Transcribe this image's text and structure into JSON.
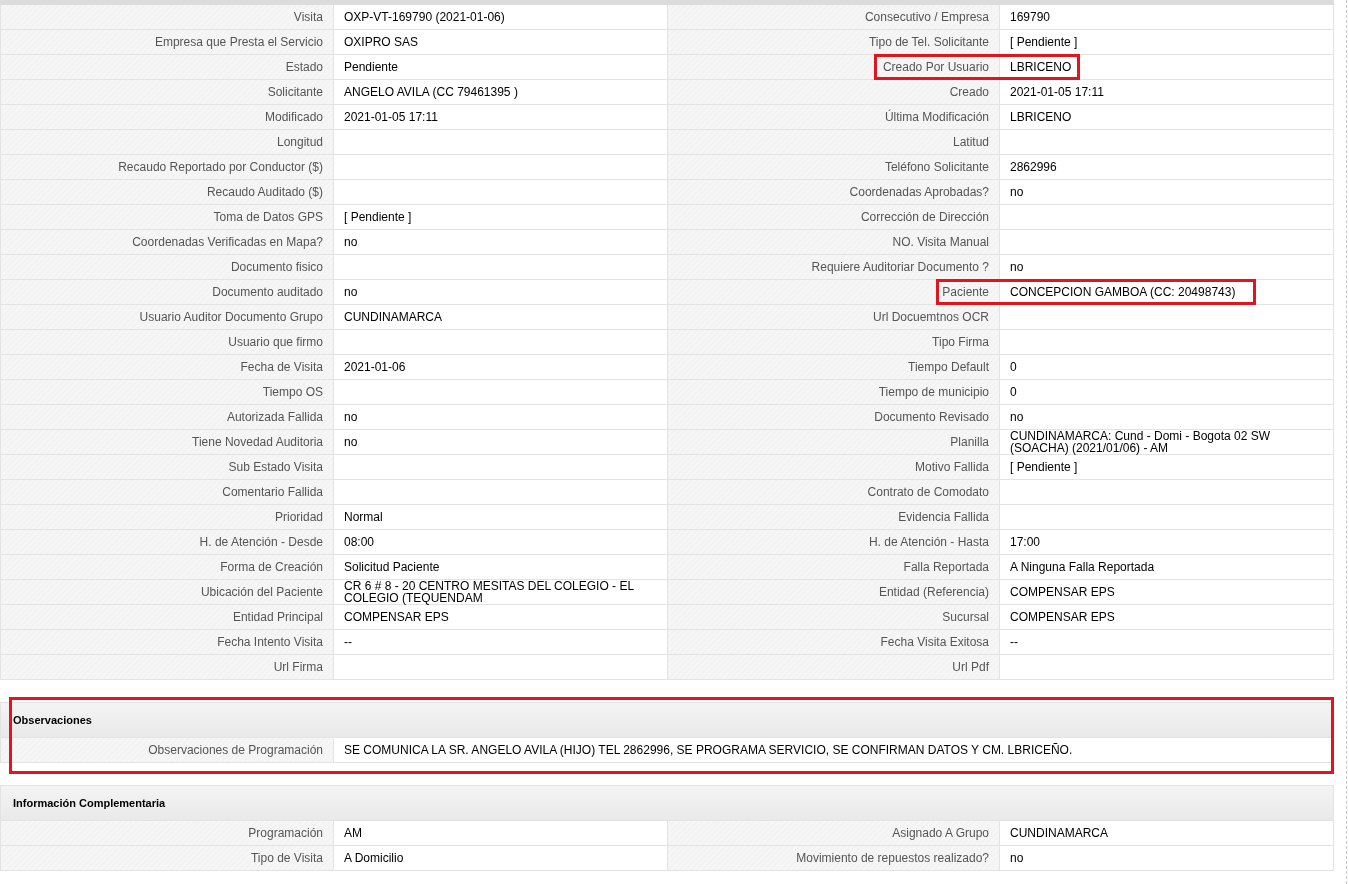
{
  "main_table": {
    "rows": [
      {
        "cells": [
          {
            "label": "Visita",
            "value": "OXP-VT-169790 (2021-01-06)",
            "highlighted": false
          },
          {
            "label": "Consecutivo / Empresa",
            "value": "169790",
            "highlighted": false
          }
        ]
      },
      {
        "cells": [
          {
            "label": "Empresa que Presta el Servicio",
            "value": "OXIPRO SAS",
            "highlighted": false
          },
          {
            "label": "Tipo de Tel. Solicitante",
            "value": "[ Pendiente ]",
            "highlighted": false
          }
        ]
      },
      {
        "cells": [
          {
            "label": "Estado",
            "value": "Pendiente",
            "highlighted": false
          },
          {
            "label": "Creado Por Usuario",
            "value": "LBRICENO",
            "highlighted": true
          }
        ]
      },
      {
        "cells": [
          {
            "label": "Solicitante",
            "value": "ANGELO AVILA (CC 79461395 )",
            "highlighted": false
          },
          {
            "label": "Creado",
            "value": "2021-01-05 17:11",
            "highlighted": false
          }
        ]
      },
      {
        "cells": [
          {
            "label": "Modificado",
            "value": "2021-01-05 17:11",
            "highlighted": false
          },
          {
            "label": "Última Modificación",
            "value": "LBRICENO",
            "highlighted": false
          }
        ]
      },
      {
        "cells": [
          {
            "label": "Longitud",
            "highlighted": false
          },
          {
            "label": "Latitud",
            "highlighted": false
          }
        ]
      },
      {
        "cells": [
          {
            "label": "Recaudo Reportado por Conductor ($)",
            "highlighted": false
          },
          {
            "label": "Teléfono Solicitante",
            "value": "2862996",
            "highlighted": false
          }
        ]
      },
      {
        "cells": [
          {
            "label": "Recaudo Auditado ($)",
            "highlighted": false
          },
          {
            "label": "Coordenadas Aprobadas?",
            "value": "no",
            "highlighted": false
          }
        ]
      },
      {
        "cells": [
          {
            "label": "Toma de Datos GPS",
            "value": "[ Pendiente ]",
            "highlighted": false
          },
          {
            "label": "Corrección de Dirección",
            "highlighted": false
          }
        ]
      },
      {
        "cells": [
          {
            "label": "Coordenadas Verificadas en Mapa?",
            "value": "no",
            "highlighted": false
          },
          {
            "label": "NO. Visita Manual",
            "highlighted": false
          }
        ]
      },
      {
        "cells": [
          {
            "label": "Documento fisico",
            "highlighted": false
          },
          {
            "label": "Requiere Auditoriar Documento ?",
            "value": "no",
            "highlighted": false
          }
        ]
      },
      {
        "cells": [
          {
            "label": "Documento auditado",
            "value": "no",
            "highlighted": false
          },
          {
            "label": "Paciente",
            "value": "CONCEPCION GAMBOA (CC: 20498743)",
            "highlighted": true
          }
        ]
      },
      {
        "cells": [
          {
            "label": "Usuario Auditor Documento Grupo",
            "value": "CUNDINAMARCA",
            "highlighted": false
          },
          {
            "label": "Url Docuemtnos OCR",
            "highlighted": false
          }
        ]
      },
      {
        "cells": [
          {
            "label": "Usuario que firmo",
            "highlighted": false
          },
          {
            "label": "Tipo Firma",
            "highlighted": false
          }
        ]
      },
      {
        "cells": [
          {
            "label": "Fecha de Visita",
            "value": "2021-01-06",
            "highlighted": false
          },
          {
            "label": "Tiempo Default",
            "value": "0",
            "highlighted": false
          }
        ]
      },
      {
        "cells": [
          {
            "label": "Tiempo OS",
            "highlighted": false
          },
          {
            "label": "Tiempo de municipio",
            "value": "0",
            "highlighted": false
          }
        ]
      },
      {
        "cells": [
          {
            "label": "Autorizada Fallida",
            "value": "no",
            "highlighted": false
          },
          {
            "label": "Documento Revisado",
            "value": "no",
            "highlighted": false
          }
        ]
      },
      {
        "cells": [
          {
            "label": "Tiene Novedad Auditoria",
            "value": "no",
            "highlighted": false
          },
          {
            "label": "Planilla",
            "value": "CUNDINAMARCA: Cund - Domi - Bogota 02 SW (SOACHA) (2021/01/06) - AM",
            "highlighted": false
          }
        ]
      },
      {
        "cells": [
          {
            "label": "Sub Estado Visita",
            "highlighted": false
          },
          {
            "label": "Motivo Fallida",
            "value": "[ Pendiente ]",
            "highlighted": false
          }
        ]
      },
      {
        "cells": [
          {
            "label": "Comentario Fallida",
            "highlighted": false
          },
          {
            "label": "Contrato de Comodato",
            "highlighted": false
          }
        ]
      },
      {
        "cells": [
          {
            "label": "Prioridad",
            "value": "Normal",
            "highlighted": false
          },
          {
            "label": "Evidencia Fallida",
            "highlighted": false
          }
        ]
      },
      {
        "cells": [
          {
            "label": "H. de Atención - Desde",
            "value": "08:00",
            "highlighted": false
          },
          {
            "label": "H. de Atención - Hasta",
            "value": "17:00",
            "highlighted": false
          }
        ]
      },
      {
        "cells": [
          {
            "label": "Forma de Creación",
            "value": "Solicitud Paciente",
            "highlighted": false
          },
          {
            "label": "Falla Reportada",
            "value": "A Ninguna Falla Reportada",
            "highlighted": false
          }
        ]
      },
      {
        "cells": [
          {
            "label": "Ubicación del Paciente",
            "value": "CR 6 # 8 - 20 CENTRO MESITAS DEL COLEGIO - EL COLEGIO (TEQUENDAM",
            "highlighted": false
          },
          {
            "label": "Entidad (Referencia)",
            "value": "COMPENSAR EPS",
            "highlighted": false
          }
        ]
      },
      {
        "cells": [
          {
            "label": "Entidad Principal",
            "value": "COMPENSAR EPS",
            "highlighted": false
          },
          {
            "label": "Sucursal",
            "value": "COMPENSAR EPS",
            "highlighted": false
          }
        ]
      },
      {
        "cells": [
          {
            "label": "Fecha Intento Visita",
            "value": "--",
            "highlighted": false
          },
          {
            "label": "Fecha Visita Exitosa",
            "value": "--",
            "highlighted": false
          }
        ]
      },
      {
        "cells": [
          {
            "label": "Url Firma",
            "highlighted": false
          },
          {
            "label": "Url Pdf",
            "highlighted": false
          }
        ]
      }
    ]
  },
  "sections": [
    {
      "title": "Observaciones",
      "highlighted": true,
      "rows": [
        {
          "cells": [
            {
              "label": "Observaciones de Programación",
              "value": "SE COMUNICA LA SR. ANGELO AVILA (HIJO) TEL 2862996, SE PROGRAMA SERVICIO, SE CONFIRMAN DATOS Y CM. LBRICEÑO.",
              "highlighted": false
            }
          ]
        }
      ]
    },
    {
      "title": "Información Complementaria",
      "highlighted": false,
      "rows": [
        {
          "cells": [
            {
              "label": "Programación",
              "value": "AM",
              "highlighted": false
            },
            {
              "label": "Asignado A Grupo",
              "value": "CUNDINAMARCA",
              "highlighted": false
            }
          ]
        },
        {
          "cells": [
            {
              "label": "Tipo de Visita",
              "value": "A Domicilio",
              "highlighted": false
            },
            {
              "label": "Movimiento de repuestos realizado?",
              "value": "no",
              "highlighted": false
            }
          ]
        }
      ]
    }
  ]
}
